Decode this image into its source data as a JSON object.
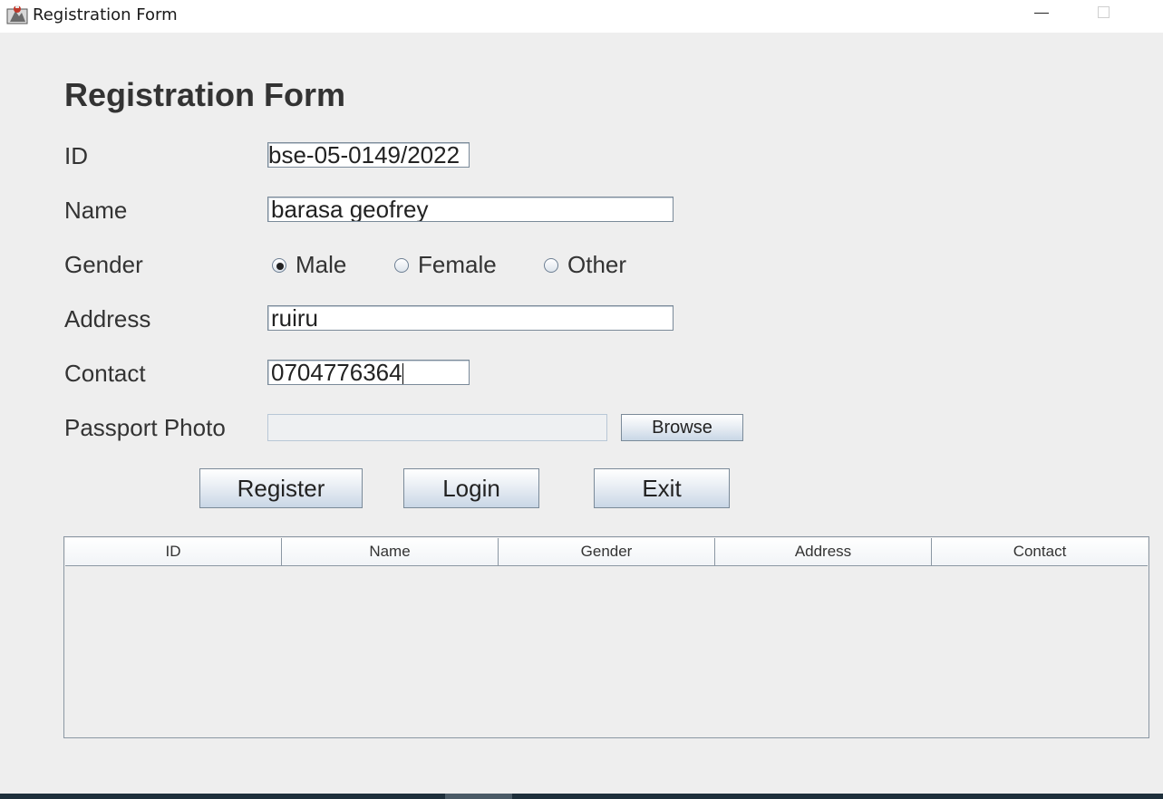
{
  "window": {
    "title": "Registration Form",
    "icon": "java-app-icon"
  },
  "form": {
    "heading": "Registration Form",
    "fields": {
      "id": {
        "label": "ID",
        "value": "bse-05-0149/2022"
      },
      "name": {
        "label": "Name",
        "value": "barasa geofrey"
      },
      "gender": {
        "label": "Gender",
        "options": [
          "Male",
          "Female",
          "Other"
        ],
        "selected": "Male"
      },
      "address": {
        "label": "Address",
        "value": "ruiru"
      },
      "contact": {
        "label": "Contact",
        "value": "0704776364"
      },
      "passport_photo": {
        "label": "Passport Photo",
        "value": "",
        "browse_label": "Browse"
      }
    }
  },
  "actions": {
    "register_label": "Register",
    "login_label": "Login",
    "exit_label": "Exit"
  },
  "table": {
    "columns": [
      "ID",
      "Name",
      "Gender",
      "Address",
      "Contact"
    ],
    "rows": []
  },
  "colors": {
    "background": "#eeeeee",
    "text": "#333333",
    "button_gradient_bottom": "#c9d7e6",
    "border": "#7a8a99",
    "taskbar": "#1e2f3b"
  }
}
